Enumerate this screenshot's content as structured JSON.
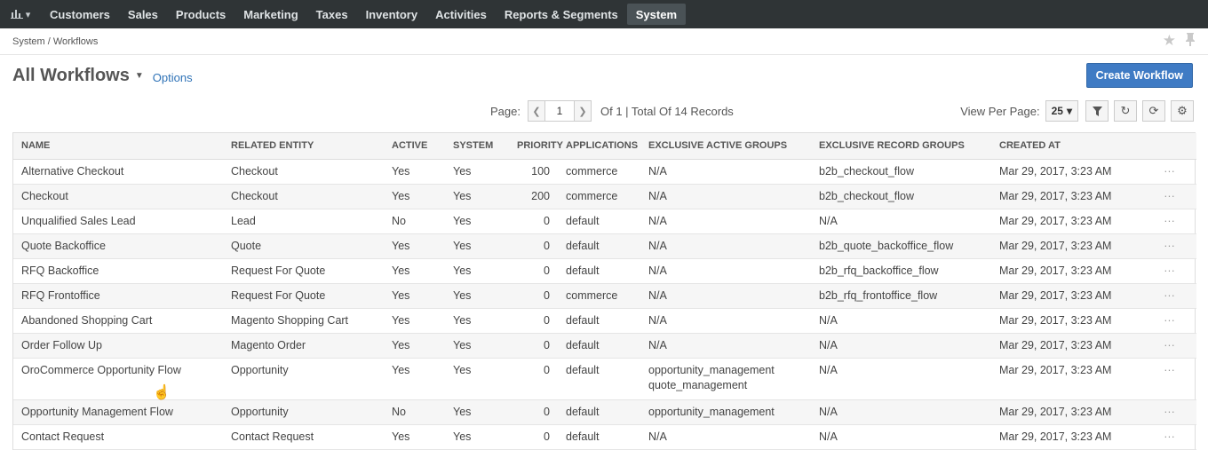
{
  "nav": {
    "items": [
      "Customers",
      "Sales",
      "Products",
      "Marketing",
      "Taxes",
      "Inventory",
      "Activities",
      "Reports & Segments",
      "System"
    ],
    "active": "System"
  },
  "breadcrumb": "System / Workflows",
  "header": {
    "title": "All Workflows",
    "options": "Options",
    "create_button": "Create Workflow"
  },
  "pager": {
    "label": "Page:",
    "page": "1",
    "total": "Of 1 | Total Of 14 Records",
    "view_per_page_label": "View Per Page:",
    "view_per_page": "25"
  },
  "columns": [
    "Name",
    "Related Entity",
    "Active",
    "System",
    "Priority",
    "Applications",
    "Exclusive Active Groups",
    "Exclusive Record Groups",
    "Created At"
  ],
  "rows": [
    {
      "name": "Alternative Checkout",
      "entity": "Checkout",
      "active": "Yes",
      "system": "Yes",
      "priority": "100",
      "applications": "commerce",
      "active_groups": "N/A",
      "record_groups": "b2b_checkout_flow",
      "created": "Mar 29, 2017, 3:23 AM"
    },
    {
      "name": "Checkout",
      "entity": "Checkout",
      "active": "Yes",
      "system": "Yes",
      "priority": "200",
      "applications": "commerce",
      "active_groups": "N/A",
      "record_groups": "b2b_checkout_flow",
      "created": "Mar 29, 2017, 3:23 AM"
    },
    {
      "name": "Unqualified Sales Lead",
      "entity": "Lead",
      "active": "No",
      "system": "Yes",
      "priority": "0",
      "applications": "default",
      "active_groups": "N/A",
      "record_groups": "N/A",
      "created": "Mar 29, 2017, 3:23 AM"
    },
    {
      "name": "Quote Backoffice",
      "entity": "Quote",
      "active": "Yes",
      "system": "Yes",
      "priority": "0",
      "applications": "default",
      "active_groups": "N/A",
      "record_groups": "b2b_quote_backoffice_flow",
      "created": "Mar 29, 2017, 3:23 AM"
    },
    {
      "name": "RFQ Backoffice",
      "entity": "Request For Quote",
      "active": "Yes",
      "system": "Yes",
      "priority": "0",
      "applications": "default",
      "active_groups": "N/A",
      "record_groups": "b2b_rfq_backoffice_flow",
      "created": "Mar 29, 2017, 3:23 AM"
    },
    {
      "name": "RFQ Frontoffice",
      "entity": "Request For Quote",
      "active": "Yes",
      "system": "Yes",
      "priority": "0",
      "applications": "commerce",
      "active_groups": "N/A",
      "record_groups": "b2b_rfq_frontoffice_flow",
      "created": "Mar 29, 2017, 3:23 AM"
    },
    {
      "name": "Abandoned Shopping Cart",
      "entity": "Magento Shopping Cart",
      "active": "Yes",
      "system": "Yes",
      "priority": "0",
      "applications": "default",
      "active_groups": "N/A",
      "record_groups": "N/A",
      "created": "Mar 29, 2017, 3:23 AM"
    },
    {
      "name": "Order Follow Up",
      "entity": "Magento Order",
      "active": "Yes",
      "system": "Yes",
      "priority": "0",
      "applications": "default",
      "active_groups": "N/A",
      "record_groups": "N/A",
      "created": "Mar 29, 2017, 3:23 AM"
    },
    {
      "name": "OroCommerce Opportunity Flow",
      "entity": "Opportunity",
      "active": "Yes",
      "system": "Yes",
      "priority": "0",
      "applications": "default",
      "active_groups": "opportunity_management",
      "active_groups_2": "quote_management",
      "record_groups": "N/A",
      "created": "Mar 29, 2017, 3:23 AM"
    },
    {
      "name": "Opportunity Management Flow",
      "entity": "Opportunity",
      "active": "No",
      "system": "Yes",
      "priority": "0",
      "applications": "default",
      "active_groups": "opportunity_management",
      "record_groups": "N/A",
      "created": "Mar 29, 2017, 3:23 AM"
    },
    {
      "name": "Contact Request",
      "entity": "Contact Request",
      "active": "Yes",
      "system": "Yes",
      "priority": "0",
      "applications": "default",
      "active_groups": "N/A",
      "record_groups": "N/A",
      "created": "Mar 29, 2017, 3:23 AM"
    }
  ],
  "row_action": "···"
}
